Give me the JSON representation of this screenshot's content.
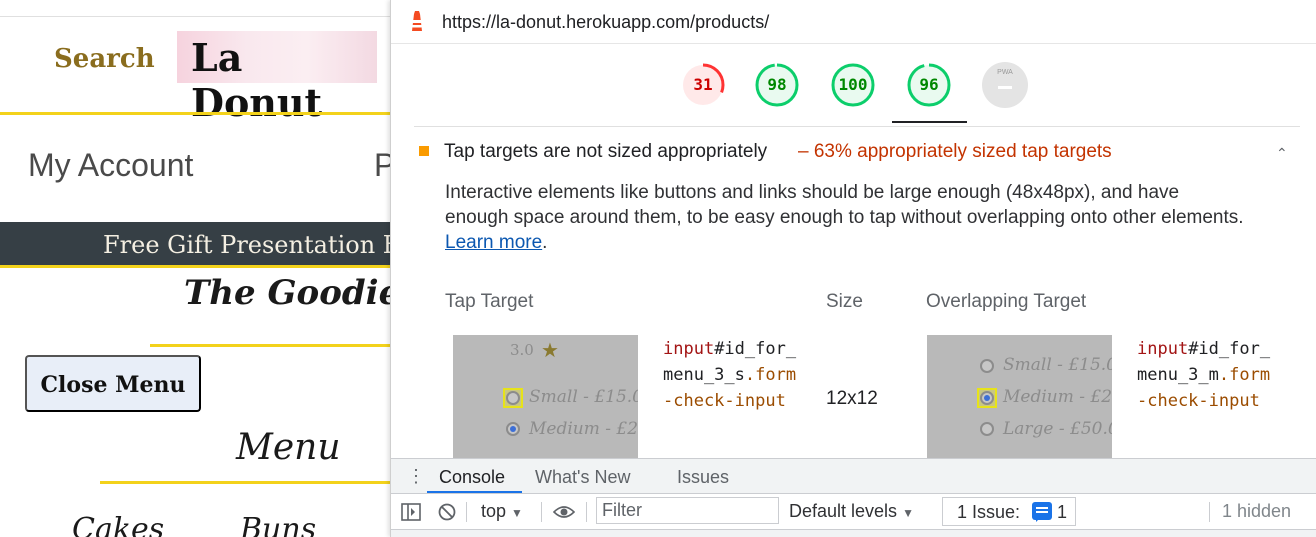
{
  "site": {
    "search_label": "Search",
    "logo_text": "La Donut",
    "my_account": "My Account",
    "partial_nav": "P",
    "banner": "Free Gift Presentation E",
    "goodies_title": "The Goodies",
    "close_menu": "Close Menu",
    "menu_title": "Menu",
    "categories": [
      "Cakes",
      "Buns"
    ],
    "colors": {
      "gold": "#8a6d1e",
      "yellow_rule": "#f3d21b",
      "banner_bg": "#363f45"
    }
  },
  "devtools": {
    "url": "https://la-donut.herokuapp.com/products/",
    "url_icon": "lighthouse-icon",
    "scores": [
      {
        "name": "performance",
        "value": 31,
        "color": "#ff3333",
        "bg": "#ffe9e9"
      },
      {
        "name": "accessibility",
        "value": 98,
        "color": "#0cce6b",
        "bg": "#e9faf0"
      },
      {
        "name": "best-practices",
        "value": 100,
        "color": "#0cce6b",
        "bg": "#e9faf0"
      },
      {
        "name": "seo",
        "value": 96,
        "color": "#0cce6b",
        "bg": "#e9faf0"
      }
    ],
    "pwa_label": "PWA",
    "audit": {
      "title": "Tap targets are not sized appropriately",
      "display_value": "– 63% appropriately sized tap targets",
      "description": "Interactive elements like buttons and links should be large enough (48x48px), and have enough space around them, to be easy enough to tap without overlapping onto other elements.",
      "learn_more": "Learn more",
      "columns": [
        "Tap Target",
        "Size",
        "Overlapping Target"
      ],
      "row": {
        "target_tag": "input",
        "target_id_1": "#id_for_",
        "target_id_2": "menu_3_s",
        "target_class_1": ".form",
        "target_class_2": "-check-input",
        "size": "12x12",
        "overlap_tag": "input",
        "overlap_id_1": "#id_for_",
        "overlap_id_2": "menu_3_m",
        "overlap_class_1": ".form",
        "overlap_class_2": "-check-input"
      },
      "thumb": {
        "rating": "3.0",
        "small": "Small - £15.0",
        "medium": "Medium - £2",
        "large": "Large - £50.0"
      }
    },
    "drawer": {
      "tabs": [
        "Console",
        "What's New",
        "Issues"
      ],
      "active_tab": "Console"
    },
    "toolbar": {
      "context": "top",
      "filter_placeholder": "Filter",
      "levels": "Default levels",
      "issues_label": "1 Issue:",
      "issues_count": "1",
      "hidden": "1 hidden"
    }
  }
}
